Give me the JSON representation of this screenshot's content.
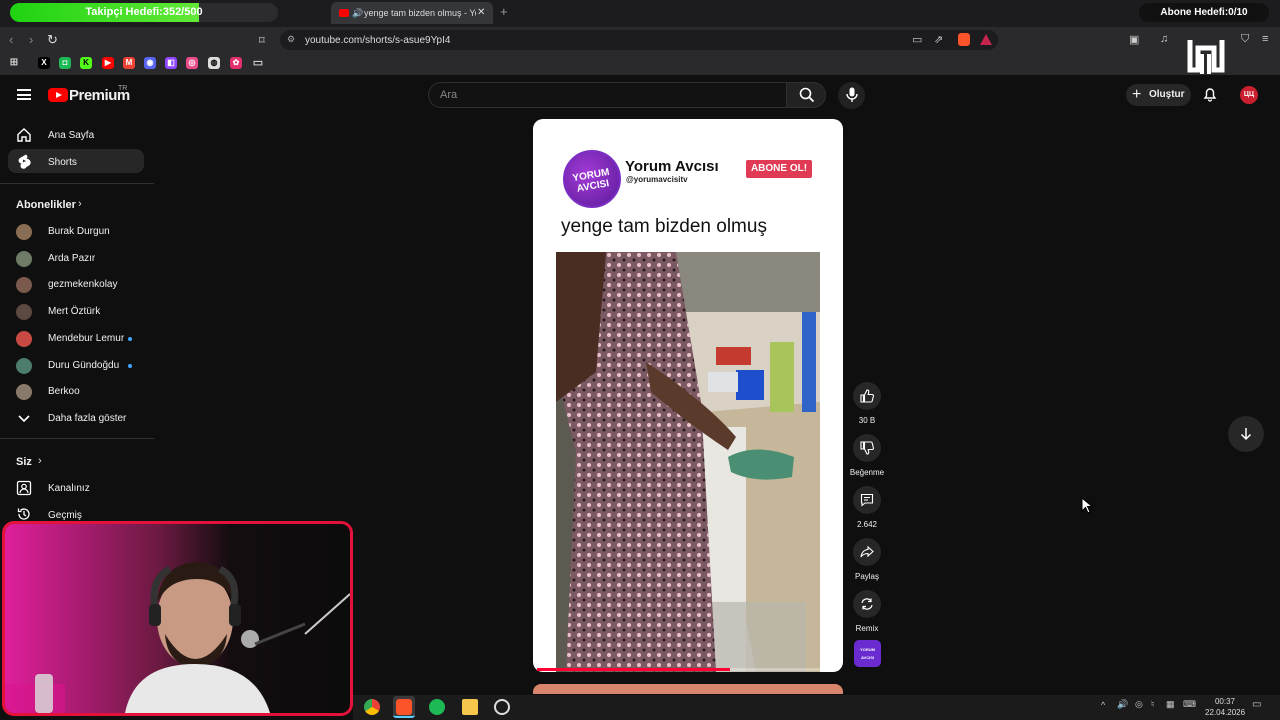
{
  "stream_overlay": {
    "follower_goal": "Takipçi Hedefi:352/500",
    "follower_progress": 0.704,
    "subscriber_goal": "Abone Hedefi:0/10"
  },
  "browser": {
    "tab_title": "yenge tam bizden olmuş - YouTube",
    "url": "youtube.com/shorts/s-asue9YpI4"
  },
  "masthead": {
    "brand": "Premium",
    "region": "TR",
    "search_placeholder": "Ara",
    "create_label": "Oluştur"
  },
  "sidebar": {
    "nav": [
      {
        "label": "Ana Sayfa"
      },
      {
        "label": "Shorts"
      }
    ],
    "subscriptions_title": "Abonelikler",
    "subscriptions": [
      {
        "label": "Burak Durgun",
        "color": "#8a6d55",
        "new": false
      },
      {
        "label": "Arda Pazır",
        "color": "#6e7b66",
        "new": false
      },
      {
        "label": "gezmekenkolay",
        "color": "#7a5a4d",
        "new": false
      },
      {
        "label": "Mert Öztürk",
        "color": "#5c4a42",
        "new": false
      },
      {
        "label": "Mendebur Lemur",
        "color": "#c94a45",
        "new": true
      },
      {
        "label": "Duru Gündoğdu",
        "color": "#4c7d6c",
        "new": true
      },
      {
        "label": "Berkoo",
        "color": "#8a7a6c",
        "new": false
      }
    ],
    "show_more": "Daha fazla göster",
    "you_title": "Siz",
    "you_items": [
      {
        "label": "Kanalınız"
      },
      {
        "label": "Geçmiş"
      }
    ]
  },
  "short": {
    "channel_name": "Yorum Avcısı",
    "channel_handle": "@yorumavcisitv",
    "avatar_text": "YORUM AVCISI",
    "subscribe_label": "ABONE OL!",
    "caption": "yenge tam bizden olmuş",
    "progress": 0.64
  },
  "actions": {
    "like_count": "30 B",
    "dislike_label": "Beğenme",
    "comment_count": "2.642",
    "share_label": "Paylaş",
    "remix_label": "Remix",
    "thumb_text": "YORUM AVCISI"
  },
  "taskbar": {
    "time": "00:37",
    "date": "22.04.2026"
  },
  "colors": {
    "accent": "#ff0000",
    "progress_green": "#1fd312",
    "webcam_border": "#e3123a"
  }
}
